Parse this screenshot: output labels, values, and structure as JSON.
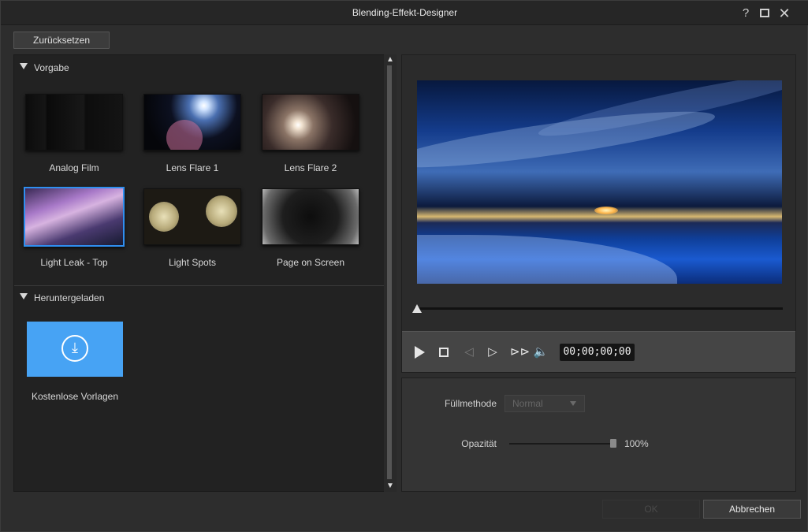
{
  "window": {
    "title": "Blending-Effekt-Designer",
    "help_glyph": "?",
    "close_glyph": "✕"
  },
  "toolbar": {
    "reset_label": "Zurücksetzen"
  },
  "presets": {
    "section_label": "Vorgabe",
    "items": [
      {
        "label": "Analog Film",
        "selected": false
      },
      {
        "label": "Lens Flare 1",
        "selected": false
      },
      {
        "label": "Lens Flare 2",
        "selected": false
      },
      {
        "label": "Light Leak - Top",
        "selected": true
      },
      {
        "label": "Light Spots",
        "selected": false
      },
      {
        "label": "Page on Screen",
        "selected": false
      }
    ]
  },
  "downloaded": {
    "section_label": "Heruntergeladen",
    "items": [
      {
        "label": "Kostenlose Vorlagen",
        "icon": "download-icon"
      }
    ]
  },
  "player": {
    "timecode": "00;00;00;00",
    "position_fraction": 0
  },
  "properties": {
    "blend_mode_label": "Füllmethode",
    "blend_mode_value": "Normal",
    "opacity_label": "Opazität",
    "opacity_value": "100%",
    "opacity_fraction": 1.0
  },
  "footer": {
    "ok_label": "OK",
    "cancel_label": "Abbrechen"
  },
  "colors": {
    "accent": "#2f8ff0",
    "download_tile": "#47a3f4"
  }
}
